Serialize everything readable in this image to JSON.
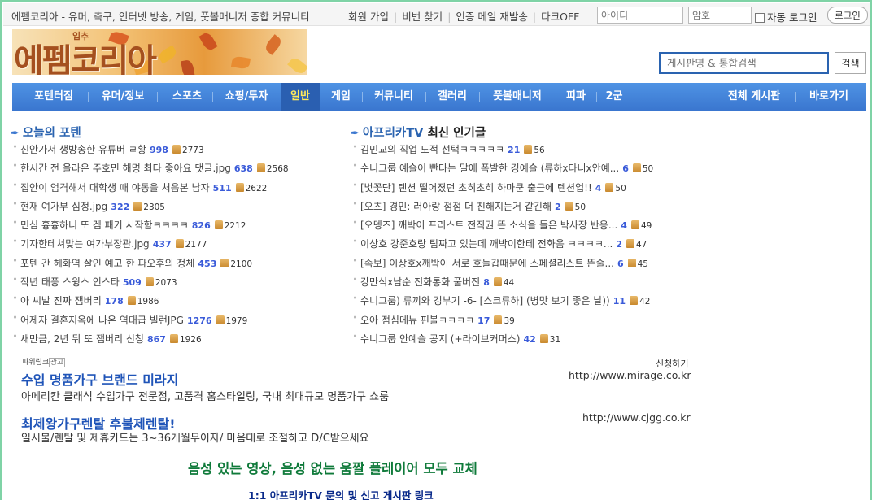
{
  "topbar": {
    "site_desc": "에펨코리아 - 유머, 축구, 인터넷 방송, 게임, 풋볼매니저 종합 커뮤니티",
    "links": [
      "회원 가입",
      "비번 찾기",
      "인증 메일 재발송",
      "다크OFF"
    ],
    "id_placeholder": "아이디",
    "pw_placeholder": "암호",
    "auto_login": "자동 로그인",
    "login_button": "로그인"
  },
  "header": {
    "logo_text": "에펨코리아",
    "logo_season": "입추",
    "search_placeholder": "게시판명 & 통합검색",
    "search_button": "검색"
  },
  "nav": {
    "items": [
      "포텐터짐",
      "유머/정보",
      "스포츠",
      "쇼핑/투자",
      "일반",
      "게임",
      "커뮤니티",
      "갤러리",
      "풋볼매니저",
      "피파",
      "2군"
    ],
    "active": "일반",
    "right_items": [
      "전체 게시판",
      "바로가기"
    ]
  },
  "colors": {
    "nav_bg": "#3a76cf",
    "active_text": "#ffe95a",
    "link_blue": "#1f54b8",
    "notice_green": "#0f7a3a",
    "frame": "#7fd3a6"
  },
  "left_section": {
    "title": "오늘의 포텐",
    "posts": [
      {
        "title": "신안가서 생방송한 유튜버 ㄹ황",
        "comments": "998",
        "likes": "2773"
      },
      {
        "title": "한시간 전 올라온 주호민 해명 최다 좋아요 댓글.jpg",
        "comments": "638",
        "likes": "2568"
      },
      {
        "title": "집안이 엄격해서 대학생 때 야동을 처음본 남자",
        "comments": "511",
        "likes": "2622"
      },
      {
        "title": "현재 여가부 심정.jpg",
        "comments": "322",
        "likes": "2305"
      },
      {
        "title": "민심 흉흉하니 또 겜 패기 시작함ㅋㅋㅋㅋ",
        "comments": "826",
        "likes": "2212"
      },
      {
        "title": "기자한테쳐맞는 여가부장관.jpg",
        "comments": "437",
        "likes": "2177"
      },
      {
        "title": "포텐 간 헤화역 살인 예고 한 파오후의 정체",
        "comments": "453",
        "likes": "2100"
      },
      {
        "title": "작년 태풍 스윙스 인스타",
        "comments": "509",
        "likes": "2073"
      },
      {
        "title": "아 씨발 진짜 잼버리",
        "comments": "178",
        "likes": "1986"
      },
      {
        "title": "어제자 결혼지옥에 나온 역대급 빌런JPG",
        "comments": "1276",
        "likes": "1979"
      },
      {
        "title": "새만금, 2년 뒤 또 잼버리 신청",
        "comments": "867",
        "likes": "1926"
      }
    ]
  },
  "right_section": {
    "title_highlight": "아프리카TV",
    "title_rest": "최신 인기글",
    "posts": [
      {
        "title": "김민교의 직업 도적 선택ㅋㅋㅋㅋㅋ",
        "comments": "21",
        "likes": "56"
      },
      {
        "title": "수니그룹 예슬이 빤다는 말에 폭발한 깅예슬 (류하x다니x안예...",
        "comments": "6",
        "likes": "50"
      },
      {
        "title": "[벛꽃단] 텐션 떨어졌던 초히초히 하마쿤 출근에 텐션업!!",
        "comments": "4",
        "likes": "50"
      },
      {
        "title": "[오츠] 경민: 러아랑 점점 더 친해지는거 같긴해",
        "comments": "2",
        "likes": "50"
      },
      {
        "title": "[오뎅즈] 깨박이 프리스트 전직권 뜬 소식을 들은 박사장 반응...",
        "comments": "4",
        "likes": "49"
      },
      {
        "title": "이상호 강준호랑 팀짜고 있는데 깨박이한테 전화옴 ㅋㅋㅋㅋ...",
        "comments": "2",
        "likes": "47"
      },
      {
        "title": "[속보] 이상호x깨박이 서로 호들갑때문에 스페셜리스트 뜬줄...",
        "comments": "6",
        "likes": "45"
      },
      {
        "title": "강만식x남순 전화통화 풀버전",
        "comments": "8",
        "likes": "44"
      },
      {
        "title": "수니그룹) 류끼와 깅부기 -6- [스크류하] (병맛 보기 좋은 날))",
        "comments": "11",
        "likes": "42"
      },
      {
        "title": "오아 점심메뉴 핀볼ㅋㅋㅋㅋ",
        "comments": "17",
        "likes": "39"
      },
      {
        "title": "수니그룹 안예슬 공지 (+라이브커머스)",
        "comments": "42",
        "likes": "31"
      }
    ]
  },
  "ads": {
    "label": "파워링크",
    "badge": "광고",
    "apply": "신청하기",
    "items": [
      {
        "title": "수입 명품가구 브랜드 미라지",
        "url": "http://www.mirage.co.kr",
        "desc": "아메리칸 클래식 수입가구 전문점, 고품격 홈스타일링, 국내 최대규모 명품가구 쇼룸"
      },
      {
        "title": "최제왕가구렌탈 후불제렌탈!",
        "url": "http://www.cjgg.co.kr",
        "desc": "일시불/렌탈 및 제휴카드는 3~36개월무이자/ 마음대로 조절하고 D/C받으세요"
      }
    ]
  },
  "notice": "음성 있는 영상, 음성 없는 움짤 플레이어 모두 교체",
  "inquiry": "1:1 아프리카TV 문의 및 신고 게시판 링크"
}
